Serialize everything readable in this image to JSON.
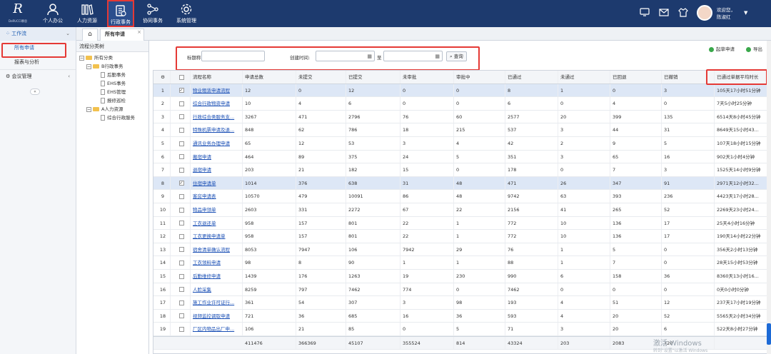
{
  "logo": {
    "mark": "R",
    "sub": "DeRUCCI慕思"
  },
  "nav": [
    {
      "label": "个人办公",
      "icon": "person-icon"
    },
    {
      "label": "人力资源",
      "icon": "books-icon"
    },
    {
      "label": "行政事务",
      "icon": "document-icon"
    },
    {
      "label": "协同事务",
      "icon": "share-icon"
    },
    {
      "label": "系统管理",
      "icon": "gear-icon"
    }
  ],
  "user": {
    "welcome": "欢迎您，",
    "name": "陈淑红"
  },
  "sidebar": {
    "section": "工作流",
    "items": [
      "所有申请",
      "报表与分析"
    ],
    "section2": "会议管理"
  },
  "tabs": {
    "current": "所有申请"
  },
  "tree": {
    "title": "流程分类树",
    "root": "所有分类",
    "groupB": "B行政事务",
    "childrenB": [
      "后勤事务",
      "EHS事务",
      "EHS管理",
      "报修巡检"
    ],
    "groupA": "A人力资源",
    "childrenA": [
      "综合行政服务"
    ]
  },
  "search": {
    "name_label": "标题称",
    "time_label": "创建时间:",
    "to_label": "至",
    "query_btn": "查询"
  },
  "actions": {
    "start": "起草申请",
    "export": "导出"
  },
  "columns": [
    "流程名称",
    "申请总数",
    "未提交",
    "已提交",
    "未审批",
    "审批中",
    "已通过",
    "未通过",
    "已回退",
    "已撤销",
    "已通过单据平均时长"
  ],
  "rows": [
    {
      "n": "1",
      "checked": true,
      "name": "物业租赁申请流程",
      "v": [
        "12",
        "0",
        "12",
        "0",
        "0",
        "8",
        "1",
        "0",
        "3",
        "105天17小时51分钟"
      ]
    },
    {
      "n": "2",
      "checked": false,
      "name": "综合行政物资申请",
      "v": [
        "10",
        "4",
        "6",
        "0",
        "0",
        "6",
        "0",
        "4",
        "0",
        "7天5小时25分钟"
      ]
    },
    {
      "n": "3",
      "checked": false,
      "name": "行政综合类服务支...",
      "v": [
        "3267",
        "471",
        "2796",
        "76",
        "60",
        "2577",
        "20",
        "399",
        "135",
        "6514天8小时45分钟"
      ]
    },
    {
      "n": "4",
      "checked": false,
      "name": "特殊机票申请及退...",
      "v": [
        "848",
        "62",
        "786",
        "18",
        "215",
        "537",
        "3",
        "44",
        "31",
        "8649天15小时43..."
      ]
    },
    {
      "n": "5",
      "checked": false,
      "name": "通讯业务办理申请",
      "v": [
        "65",
        "12",
        "53",
        "3",
        "4",
        "42",
        "2",
        "9",
        "5",
        "107天18小时15分钟"
      ]
    },
    {
      "n": "6",
      "checked": false,
      "name": "搬宿申请",
      "v": [
        "464",
        "89",
        "375",
        "24",
        "5",
        "351",
        "3",
        "65",
        "16",
        "902天1小时4分钟"
      ]
    },
    {
      "n": "7",
      "checked": false,
      "name": "退宿申请",
      "v": [
        "203",
        "21",
        "182",
        "15",
        "0",
        "178",
        "0",
        "7",
        "3",
        "1525天14小时9分钟"
      ]
    },
    {
      "n": "8",
      "checked": true,
      "name": "住宿申请单",
      "v": [
        "1014",
        "376",
        "638",
        "31",
        "48",
        "471",
        "26",
        "347",
        "91",
        "2971天12小时32..."
      ]
    },
    {
      "n": "9",
      "checked": false,
      "name": "客房申请表",
      "v": [
        "10570",
        "479",
        "10091",
        "86",
        "48",
        "9742",
        "63",
        "393",
        "236",
        "4423天17小时28..."
      ]
    },
    {
      "n": "10",
      "checked": false,
      "name": "物品申领单",
      "v": [
        "2603",
        "331",
        "2272",
        "67",
        "22",
        "2156",
        "41",
        "265",
        "52",
        "2269天23小时24..."
      ]
    },
    {
      "n": "11",
      "checked": false,
      "name": "工衣退还单",
      "v": [
        "958",
        "157",
        "801",
        "22",
        "1",
        "772",
        "10",
        "136",
        "17",
        "25天4小时16分钟"
      ]
    },
    {
      "n": "12",
      "checked": false,
      "name": "工衣更换申请单",
      "v": [
        "958",
        "157",
        "801",
        "22",
        "1",
        "772",
        "10",
        "136",
        "17",
        "190天14小时22分钟"
      ]
    },
    {
      "n": "13",
      "checked": false,
      "name": "宿舍清单确认流程",
      "v": [
        "8053",
        "7947",
        "106",
        "7942",
        "29",
        "76",
        "1",
        "5",
        "0",
        "356天2小时13分钟"
      ]
    },
    {
      "n": "14",
      "checked": false,
      "name": "工衣领料申请",
      "v": [
        "98",
        "8",
        "90",
        "1",
        "1",
        "88",
        "1",
        "7",
        "0",
        "28天15小时53分钟"
      ]
    },
    {
      "n": "15",
      "checked": false,
      "name": "后勤维修申请",
      "v": [
        "1439",
        "176",
        "1263",
        "19",
        "230",
        "990",
        "6",
        "158",
        "36",
        "8360天13小时16..."
      ]
    },
    {
      "n": "16",
      "checked": false,
      "name": "人脸采集",
      "v": [
        "8259",
        "797",
        "7462",
        "774",
        "0",
        "7462",
        "0",
        "0",
        "0",
        "0天0小时0分钟"
      ]
    },
    {
      "n": "17",
      "checked": false,
      "name": "施工作业许可证行...",
      "v": [
        "361",
        "54",
        "307",
        "3",
        "98",
        "193",
        "4",
        "51",
        "12",
        "237天17小时19分钟"
      ]
    },
    {
      "n": "18",
      "checked": false,
      "name": "视频监控调取申请",
      "v": [
        "721",
        "36",
        "685",
        "16",
        "36",
        "593",
        "4",
        "20",
        "52",
        "5565天2小时34分钟"
      ]
    },
    {
      "n": "19",
      "checked": false,
      "name": "厂区内物品出厂申...",
      "v": [
        "106",
        "21",
        "85",
        "0",
        "5",
        "71",
        "3",
        "20",
        "6",
        "522天8小时27分钟"
      ]
    }
  ],
  "totals": [
    "411476",
    "366369",
    "45107",
    "355524",
    "814",
    "43324",
    "203",
    "2083",
    "720",
    ""
  ],
  "watermark": {
    "line1": "激活 Windows",
    "line2": "转到\"设置\"以激活 Windows"
  }
}
